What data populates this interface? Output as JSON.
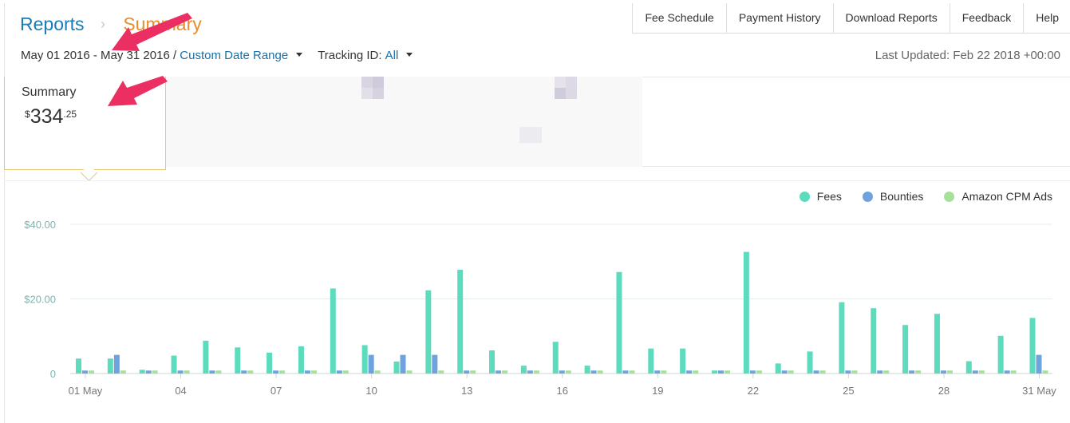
{
  "breadcrumb": {
    "root": "Reports",
    "separator": "›",
    "current": "Summary"
  },
  "topnav": {
    "items": [
      "Fee Schedule",
      "Payment History",
      "Download Reports",
      "Feedback",
      "Help"
    ]
  },
  "filters": {
    "date_range": "May 01 2016 - May 31 2016 /",
    "date_range_link": "Custom Date Range",
    "tracking_label": "Tracking ID:",
    "tracking_value": "All"
  },
  "last_updated": "Last Updated: Feb 22 2018 +00:00",
  "summary": {
    "title": "Summary",
    "currency": "$",
    "amount": "334",
    "cents": ".25"
  },
  "icons": {
    "dropdown": "caret-down-icon",
    "annotation": "red-arrow-icon"
  },
  "colors": {
    "fees": "#5ddbbd",
    "bounties": "#6ea3de",
    "cpm": "#a6e19a",
    "accent_link": "#1a6fa8",
    "accent_orange": "#e88e2e",
    "arrow": "#ec2f62"
  },
  "chart_data": {
    "type": "bar",
    "legend_position": "top-right",
    "grid": true,
    "y_tick_labels": [
      "0",
      "$20.00",
      "$40.00"
    ],
    "y_ticks": [
      0,
      20,
      40
    ],
    "ylim": [
      0,
      40
    ],
    "x_tick_labels": [
      "01 May",
      "04",
      "07",
      "10",
      "13",
      "16",
      "19",
      "22",
      "25",
      "28",
      "31 May"
    ],
    "x_tick_days": [
      1,
      4,
      7,
      10,
      13,
      16,
      19,
      22,
      25,
      28,
      31
    ],
    "days": [
      1,
      2,
      3,
      4,
      5,
      6,
      7,
      8,
      9,
      10,
      11,
      12,
      13,
      14,
      15,
      16,
      17,
      18,
      19,
      20,
      21,
      22,
      23,
      24,
      25,
      26,
      27,
      28,
      29,
      30,
      31
    ],
    "series": [
      {
        "name": "Fees",
        "color": "#5ddbbd",
        "values": [
          4.0,
          4.0,
          1.0,
          4.8,
          8.8,
          7.0,
          5.6,
          7.3,
          22.8,
          7.6,
          3.2,
          22.3,
          27.8,
          6.2,
          2.1,
          8.5,
          2.1,
          27.2,
          6.7,
          6.7,
          0.8,
          32.6,
          2.7,
          5.9,
          19.1,
          17.5,
          13.0,
          16.0,
          3.3,
          10.1,
          14.9
        ]
      },
      {
        "name": "Bounties",
        "color": "#6ea3de",
        "values": [
          0.8,
          5.0,
          0.8,
          0.8,
          0.8,
          0.8,
          0.8,
          0.8,
          0.8,
          5.0,
          5.0,
          5.0,
          0.8,
          0.8,
          0.8,
          0.8,
          0.8,
          0.8,
          0.8,
          0.8,
          0.8,
          0.8,
          0.8,
          0.8,
          0.8,
          0.8,
          0.8,
          0.8,
          0.8,
          0.8,
          5.0
        ]
      },
      {
        "name": "Amazon CPM Ads",
        "color": "#a6e19a",
        "values": [
          0.8,
          0.8,
          0.8,
          0.8,
          0.8,
          0.8,
          0.8,
          0.8,
          0.8,
          0.8,
          0.8,
          0.8,
          0.8,
          0.8,
          0.8,
          0.8,
          0.8,
          0.8,
          0.8,
          0.8,
          0.8,
          0.8,
          0.8,
          0.8,
          0.8,
          0.8,
          0.8,
          0.8,
          0.8,
          0.8,
          0.8
        ]
      }
    ]
  }
}
